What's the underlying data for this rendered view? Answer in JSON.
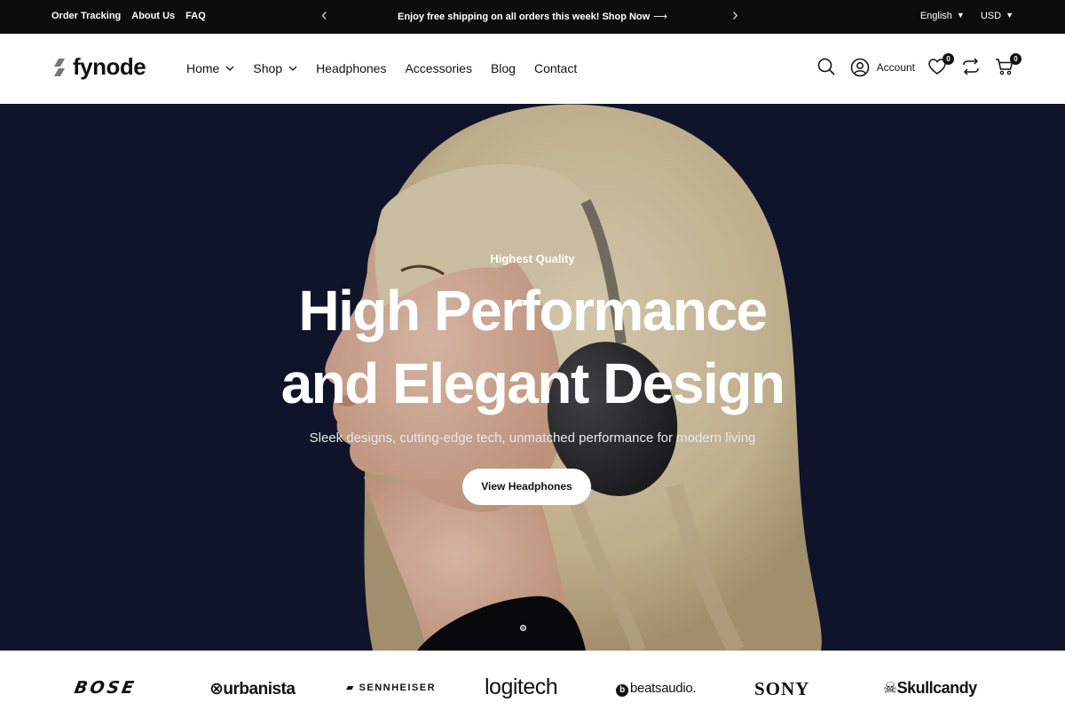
{
  "topbar": {
    "links": [
      "Order Tracking",
      "About Us",
      "FAQ"
    ],
    "announcement": "Enjoy free shipping on all orders this week!",
    "announcement_cta": "Shop Now",
    "language": "English",
    "currency": "USD"
  },
  "header": {
    "logo": "fynode",
    "nav": [
      {
        "label": "Home"
      },
      {
        "label": "Shop"
      },
      {
        "label": "Headphones"
      },
      {
        "label": "Accessories"
      },
      {
        "label": "Blog"
      },
      {
        "label": "Contact"
      }
    ],
    "account_label": "Account",
    "wishlist_count": "0",
    "cart_count": "0"
  },
  "hero": {
    "eyebrow": "Highest Quality",
    "headline_line1": "High Performance",
    "headline_line2": "and Elegant Design",
    "subline": "Sleek designs, cutting-edge tech, unmatched performance for modern living",
    "cta": "View Headphones",
    "background": "#121732"
  },
  "brands": [
    "BOSE",
    "urbanista",
    "SENNHEISER",
    "logitech",
    "beatsaudio.",
    "SONY",
    "Skullcandy"
  ],
  "colors": {
    "topbar": "#0d0d0d",
    "accent": "#111111",
    "hero_bg": "#121732"
  }
}
